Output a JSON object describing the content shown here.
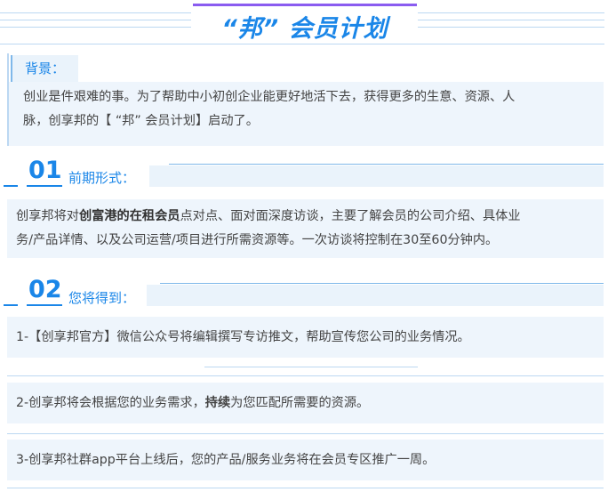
{
  "header": {
    "title": "“邦” 会员计划"
  },
  "background": {
    "label": "背景：",
    "line1": "创业是件艰难的事。为了帮助中小初创企业能更好地活下去，获得更多的生意、资源、人",
    "line2": "脉，创享邦的【 “邦” 会员计划】启动了。"
  },
  "section1": {
    "number": "01",
    "title": "前期形式：",
    "line1_before": "创享邦将对",
    "line1_bold": "创富港的在租会员",
    "line1_after": "点对点、面对面深度访谈，主要了解会员的公司介绍、具体业",
    "line2": "务/产品详情、以及公司运营/项目进行所需资源等。一次访谈将控制在30至60分钟内。"
  },
  "section2": {
    "number": "02",
    "title": "您将得到：",
    "item1": "1-【创享邦官方】微信公众号将编辑撰写专访推文，帮助宣传您公司的业务情况。",
    "item2_before": "2-创享邦将会根据您的业务需求，",
    "item2_bold": "持续",
    "item2_after": "为您匹配所需要的资源。",
    "item3": "3-创享邦社群app平台上线后，您的产品/服务业务将在会员专区推广一周。"
  }
}
